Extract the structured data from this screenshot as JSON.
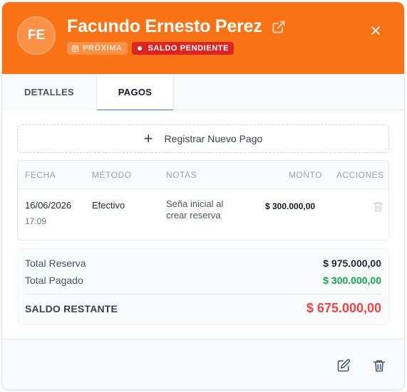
{
  "header": {
    "initials": "FE",
    "name": "Facundo Ernesto Perez",
    "badges": {
      "status": "PRÓXIMA",
      "balance": "SALDO PENDIENTE"
    },
    "accent": "#f97316"
  },
  "tabs": [
    {
      "label": "DETALLES",
      "active": false
    },
    {
      "label": "PAGOS",
      "active": true
    }
  ],
  "pagos": {
    "add_label": "Registrar Nuevo Pago",
    "columns": {
      "fecha": "FECHA",
      "metodo": "MÉTODO",
      "notas": "NOTAS",
      "monto": "MONTO",
      "acciones": "ACCIONES"
    },
    "rows": [
      {
        "fecha": "16/06/2026",
        "hora": "17:09",
        "metodo": "Efectivo",
        "notas": "Seña inicial al crear reserva",
        "monto": "$ 300.000,00"
      }
    ]
  },
  "totals": {
    "reserva_label": "Total Reserva",
    "reserva_value": "$ 975.000,00",
    "pagado_label": "Total Pagado",
    "pagado_value": "$ 300.000,00",
    "pagado_color": "#16a34a",
    "saldo_label": "SALDO RESTANTE",
    "saldo_value": "$ 675.000,00",
    "saldo_color": "#ef4444"
  },
  "icons": {
    "external": "external-link-icon",
    "close": "close-icon",
    "calendar": "calendar-icon",
    "trash": "trash-icon",
    "edit": "edit-icon"
  }
}
